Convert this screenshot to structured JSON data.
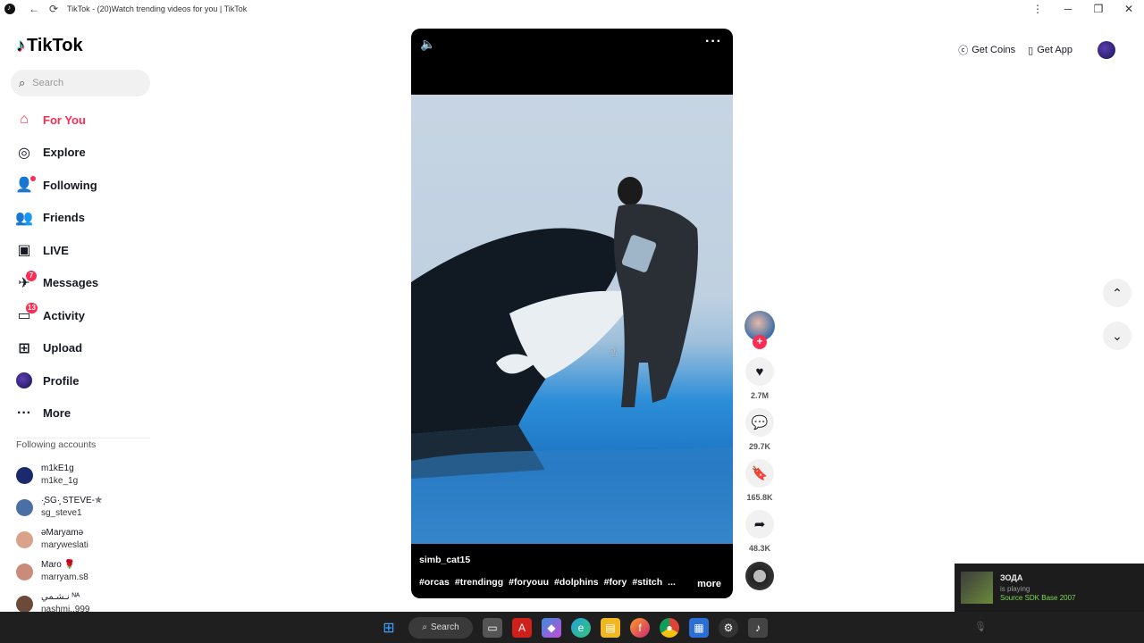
{
  "window": {
    "title": "TikTok - (20)Watch trending videos for you | TikTok",
    "back_icon": "←",
    "reload_icon": "⟳",
    "menu_icon": "⋮",
    "minimize_icon": "─",
    "restore_icon": "❐",
    "close_icon": "✕"
  },
  "sidebar": {
    "logo_text": "TikTok",
    "search_placeholder": "Search",
    "nav": [
      {
        "label": "For You",
        "icon": "⌂"
      },
      {
        "label": "Explore",
        "icon": "◎"
      },
      {
        "label": "Following",
        "icon": "👤"
      },
      {
        "label": "Friends",
        "icon": "👥"
      },
      {
        "label": "LIVE",
        "icon": "▣"
      },
      {
        "label": "Messages",
        "icon": "✈",
        "badge": "7"
      },
      {
        "label": "Activity",
        "icon": "▭",
        "badge": "13"
      },
      {
        "label": "Upload",
        "icon": "⊞"
      },
      {
        "label": "Profile",
        "icon": ""
      },
      {
        "label": "More",
        "icon": "···"
      }
    ],
    "following_title": "Following accounts",
    "accounts": [
      {
        "name": "m1kE1g",
        "username": "m1ke_1g",
        "color": "#1a2a6c"
      },
      {
        "name": "·̩͙SG·̩͙ STEVE-✯",
        "username": "sg_steve1",
        "color": "#4a6fa5"
      },
      {
        "name": "ǝMaryamǝ",
        "username": "maryweslati",
        "color": "#d9a38a"
      },
      {
        "name": "Maro 🌹",
        "username": "marryam.s8",
        "color": "#c98b7a"
      },
      {
        "name": "نـشـمي ᴺᴬ",
        "username": "nashmi..999",
        "color": "#6b4a3a"
      }
    ]
  },
  "video": {
    "author": "simb_cat15",
    "tags": [
      "#orcas",
      "#trendingg",
      "#foryouu",
      "#dolphins",
      "#fory",
      "#stitch",
      "..."
    ],
    "more_label": "more"
  },
  "actions": {
    "likes": "2.7M",
    "comments": "29.7K",
    "saves": "165.8K",
    "shares": "48.3K"
  },
  "header": {
    "get_coins": "Get Coins",
    "get_app": "Get App"
  },
  "notification": {
    "title": "ЗОДА",
    "status": "is playing",
    "game": "Source SDK Base 2007"
  },
  "taskbar": {
    "search_label": "Search"
  }
}
